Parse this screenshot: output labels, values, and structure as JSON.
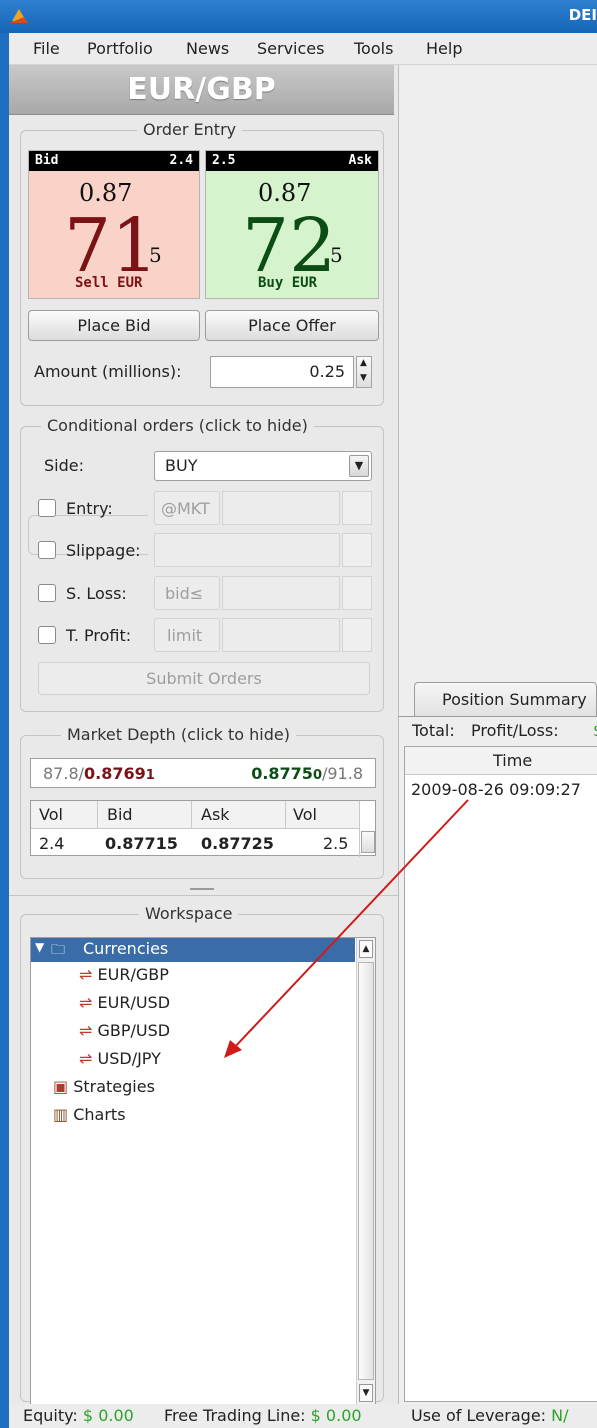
{
  "window": {
    "title_fragment": "DEI"
  },
  "menu": {
    "items": [
      "File",
      "Portfolio",
      "News",
      "Services",
      "Tools",
      "Help"
    ]
  },
  "instrument": {
    "pair": "EUR/GBP"
  },
  "order_entry": {
    "title": "Order Entry",
    "bid": {
      "label": "Bid",
      "size": "2.4",
      "big_figure": "0.87",
      "pips": "71",
      "fractional": "5",
      "action": "Sell EUR"
    },
    "ask": {
      "label": "Ask",
      "size": "2.5",
      "big_figure": "0.87",
      "pips": "72",
      "fractional": "5",
      "action": "Buy EUR"
    },
    "place_bid_label": "Place Bid",
    "place_offer_label": "Place Offer",
    "amount_label": "Amount (millions):",
    "amount_value": "0.25"
  },
  "conditional_orders": {
    "title": "Conditional orders (click to hide)",
    "side_label": "Side:",
    "side_value": "BUY",
    "entry_label": "Entry:",
    "entry_prefix": "@MKT",
    "slippage_label": "Slippage:",
    "stop_loss_label": "S. Loss:",
    "stop_loss_prefix": "bid≤",
    "take_profit_label": "T. Profit:",
    "take_profit_prefix": "limit",
    "submit_label": "Submit Orders"
  },
  "market_depth": {
    "title": "Market Depth (click to hide)",
    "summary": {
      "bid_vol": "87.8/",
      "bid_price_main": "0.8769",
      "bid_price_frac": "1",
      "ask_price_main": "0.8775",
      "ask_price_frac": "0",
      "ask_vol": "/91.8"
    },
    "columns": [
      "Vol",
      "Bid",
      "Ask",
      "Vol"
    ],
    "rows": [
      {
        "bid_vol": "2.4",
        "bid": "0.87715",
        "ask": "0.87725",
        "ask_vol": "2.5"
      }
    ]
  },
  "workspace": {
    "title": "Workspace",
    "tree": {
      "root": "Currencies",
      "children": [
        "EUR/GBP",
        "EUR/USD",
        "GBP/USD",
        "USD/JPY"
      ],
      "other": [
        "Strategies",
        "Charts"
      ]
    }
  },
  "position_summary": {
    "tab_label": "Position Summary",
    "total_label": "Total:",
    "profit_loss_label": "Profit/Loss:",
    "profit_loss_value_fragment": "$",
    "columns": [
      "Time"
    ],
    "rows": [
      "2009-08-26 09:09:27"
    ]
  },
  "status_bar": {
    "equity_label": "Equity:",
    "equity_value": "$ 0.00",
    "free_line_label": "Free Trading Line:",
    "free_line_value": "$ 0.00",
    "leverage_label": "Use of Leverage:",
    "leverage_value": "N/"
  },
  "colors": {
    "bid_dark": "#7a1216",
    "ask_dark": "#0c4d15",
    "bid_bg": "#f9d3c8",
    "ask_bg": "#d5f3cc",
    "status_green": "#2aa52a",
    "annotation_red": "#d11a1a"
  }
}
